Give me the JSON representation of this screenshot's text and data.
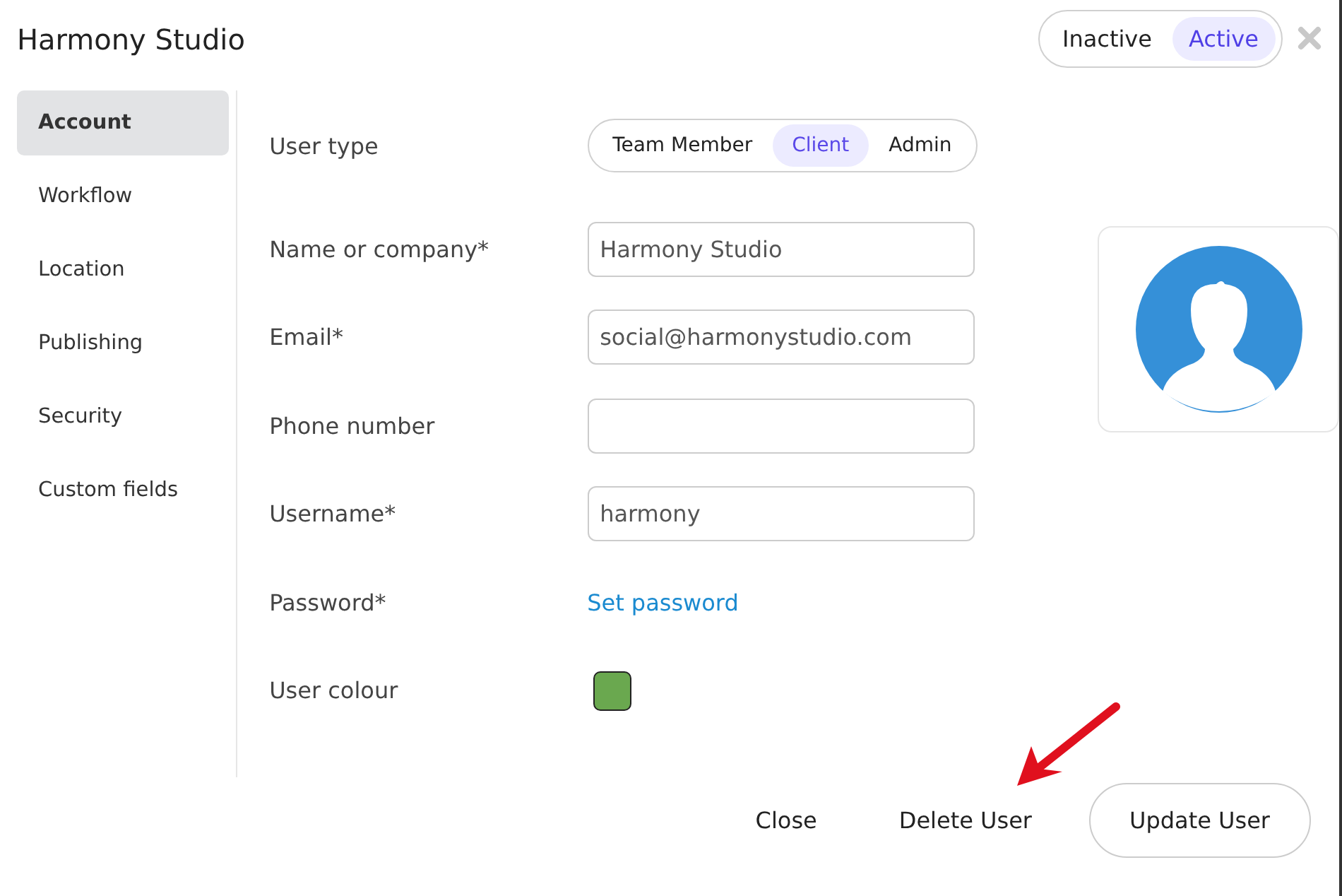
{
  "title": "Harmony Studio",
  "status_toggle": [
    {
      "label": "Inactive",
      "selected": false
    },
    {
      "label": "Active",
      "selected": true
    }
  ],
  "sidebar": {
    "items": [
      {
        "label": "Account",
        "selected": true
      },
      {
        "label": "Workflow",
        "selected": false
      },
      {
        "label": "Location",
        "selected": false
      },
      {
        "label": "Publishing",
        "selected": false
      },
      {
        "label": "Security",
        "selected": false
      },
      {
        "label": "Custom fields",
        "selected": false
      }
    ]
  },
  "form": [
    {
      "kind": "segmented",
      "label": "User type",
      "options": [
        {
          "label": "Team Member",
          "selected": false
        },
        {
          "label": "Client",
          "selected": true
        },
        {
          "label": "Admin",
          "selected": false
        }
      ]
    },
    {
      "kind": "text",
      "label": "Name or company*",
      "value": "Harmony Studio"
    },
    {
      "kind": "text",
      "label": "Email*",
      "value": "social@harmonystudio.com"
    },
    {
      "kind": "text",
      "label": "Phone number"
    },
    {
      "kind": "text",
      "label": "Username*",
      "value": "harmony"
    },
    {
      "kind": "link",
      "label": "Password*",
      "link": "Set password"
    },
    {
      "kind": "swatch",
      "label": "User colour",
      "color": "#6aa84f"
    }
  ],
  "buttons": [
    {
      "label": "Close",
      "kind": "plain"
    },
    {
      "label": "Delete User",
      "kind": "plain"
    },
    {
      "label": "Update User",
      "kind": "outlined"
    }
  ]
}
